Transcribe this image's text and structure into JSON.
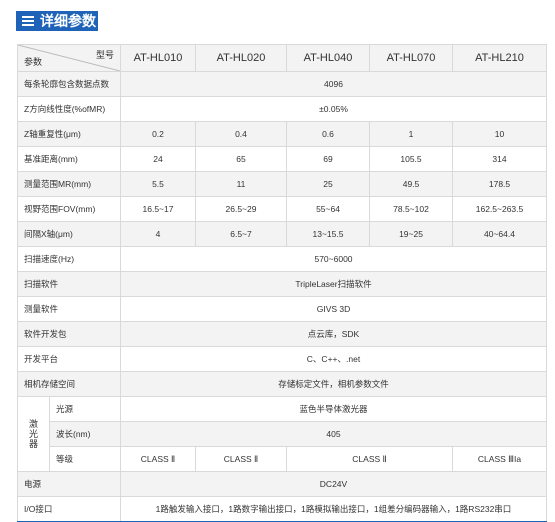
{
  "title": "详细参数",
  "header": {
    "corner_top": "型号",
    "corner_bottom": "参数",
    "models": [
      "AT-HL010",
      "AT-HL020",
      "AT-HL040",
      "AT-HL070",
      "AT-HL210"
    ]
  },
  "rows": {
    "points": {
      "label": "每条轮廓包含数据点数",
      "value": "4096"
    },
    "linearity": {
      "label": "Z方向线性度(%ofMR)",
      "value": "±0.05%"
    },
    "repeat": {
      "label": "Z轴重复性(μm)",
      "values": [
        "0.2",
        "0.4",
        "0.6",
        "1",
        "10"
      ]
    },
    "distance": {
      "label": "基准距离(mm)",
      "values": [
        "24",
        "65",
        "69",
        "105.5",
        "314"
      ]
    },
    "mr": {
      "label": "测量范围MR(mm)",
      "values": [
        "5.5",
        "11",
        "25",
        "49.5",
        "178.5"
      ]
    },
    "fov": {
      "label": "视野范围FOV(mm)",
      "values": [
        "16.5~17",
        "26.5~29",
        "55~64",
        "78.5~102",
        "162.5~263.5"
      ]
    },
    "xinterval": {
      "label": "间隔X轴(μm)",
      "values": [
        "4",
        "6.5~7",
        "13~15.5",
        "19~25",
        "40~64.4"
      ]
    },
    "speed": {
      "label": "扫描速度(Hz)",
      "value": "570~6000"
    },
    "scan_sw": {
      "label": "扫描软件",
      "value": "TripleLaser扫描软件"
    },
    "measure_sw": {
      "label": "测量软件",
      "value": "GIVS 3D"
    },
    "sdk": {
      "label": "软件开发包",
      "value": "点云库，SDK"
    },
    "platform": {
      "label": "开发平台",
      "value": "C、C++、.net"
    },
    "storage": {
      "label": "相机存储空间",
      "value": "存储标定文件，相机参数文件"
    },
    "laser": {
      "label_chars": [
        "激",
        "光",
        "器"
      ],
      "source": {
        "label": "光源",
        "value": "蓝色半导体激光器"
      },
      "wavelength": {
        "label": "波长(nm)",
        "value": "405"
      },
      "grade": {
        "label": "等级",
        "values": [
          "CLASS Ⅱ",
          "CLASS Ⅱ",
          "CLASS Ⅱ",
          "CLASS ⅢIa"
        ]
      }
    },
    "power": {
      "label": "电源",
      "value": "DC24V"
    },
    "io": {
      "label": "I/O接口",
      "value": "1路触发输入接口，1路数字输出接口，1路模拟输出接口，1组差分编码器输入，1路RS232串口"
    }
  }
}
